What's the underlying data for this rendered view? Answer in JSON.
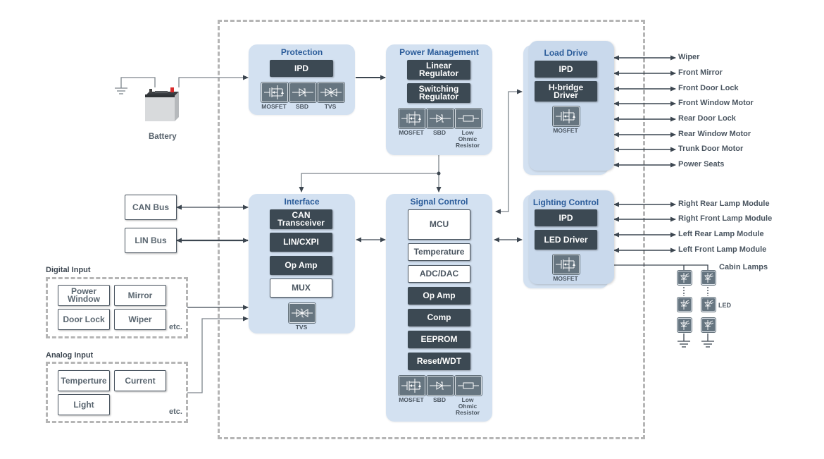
{
  "diagram": {
    "blocks": {
      "protection": {
        "title": "Protection",
        "chips": [
          "IPD"
        ],
        "components": [
          {
            "icon": "mosfet-icon",
            "label": "MOSFET"
          },
          {
            "icon": "sbd-icon",
            "label": "SBD"
          },
          {
            "icon": "tvs-icon",
            "label": "TVS"
          }
        ]
      },
      "power_management": {
        "title": "Power Management",
        "chips": [
          "Linear\nRegulator",
          "Switching\nRegulator"
        ],
        "components": [
          {
            "icon": "mosfet-icon",
            "label": "MOSFET"
          },
          {
            "icon": "sbd-icon",
            "label": "SBD"
          },
          {
            "icon": "resistor-icon",
            "label": "Low Ohmic Resistor"
          }
        ]
      },
      "load_drive": {
        "title": "Load Drive",
        "chips": [
          "IPD",
          "H-bridge\nDriver"
        ],
        "components": [
          {
            "icon": "mosfet-icon",
            "label": "MOSFET"
          }
        ]
      },
      "interface": {
        "title": "Interface",
        "chips": [
          "CAN\nTransceiver",
          "LIN/CXPI",
          "Op Amp"
        ],
        "light_chips": [
          "MUX"
        ],
        "components": [
          {
            "icon": "tvs-icon",
            "label": "TVS"
          }
        ]
      },
      "signal_control": {
        "title": "Signal Control",
        "light_chips": [
          "MCU",
          "Temperature",
          "ADC/DAC"
        ],
        "chips": [
          "Op Amp",
          "Comp",
          "EEPROM",
          "Reset/WDT"
        ],
        "components": [
          {
            "icon": "mosfet-icon",
            "label": "MOSFET"
          },
          {
            "icon": "sbd-icon",
            "label": "SBD"
          },
          {
            "icon": "resistor-icon",
            "label": "Low Ohmic Resistor"
          }
        ]
      },
      "lighting_control": {
        "title": "Lighting Control",
        "chips": [
          "IPD",
          "LED Driver"
        ],
        "components": [
          {
            "icon": "mosfet-icon",
            "label": "MOSFET"
          }
        ]
      }
    },
    "battery": {
      "label": "Battery",
      "icon": "battery-icon"
    },
    "buses": [
      "CAN Bus",
      "LIN Bus"
    ],
    "digital_input": {
      "title": "Digital Input",
      "items": [
        "Power\nWindow",
        "Mirror",
        "Door Lock",
        "Wiper"
      ],
      "etc": "etc."
    },
    "analog_input": {
      "title": "Analog Input",
      "items": [
        "Temperture",
        "Current",
        "Light"
      ],
      "etc": "etc."
    },
    "load_outputs": [
      "Wiper",
      "Front Mirror",
      "Front Door Lock",
      "Front Window Motor",
      "Rear Door Lock",
      "Rear Window Motor",
      "Trunk Door Motor",
      "Power Seats"
    ],
    "lamp_outputs": [
      "Right Rear Lamp Module",
      "Right Front Lamp Module",
      "Left Rear Lamp Module",
      "Left Front Lamp Module"
    ],
    "cabin_lamps": {
      "label": "Cabin Lamps",
      "led_label": "LED"
    },
    "colors": {
      "block_fill": "#d3e1f1",
      "block_title": "#2b5c9a",
      "chip_dark": "#3c4953",
      "wire": "#8a9096",
      "arrow": "#3c4650"
    }
  }
}
